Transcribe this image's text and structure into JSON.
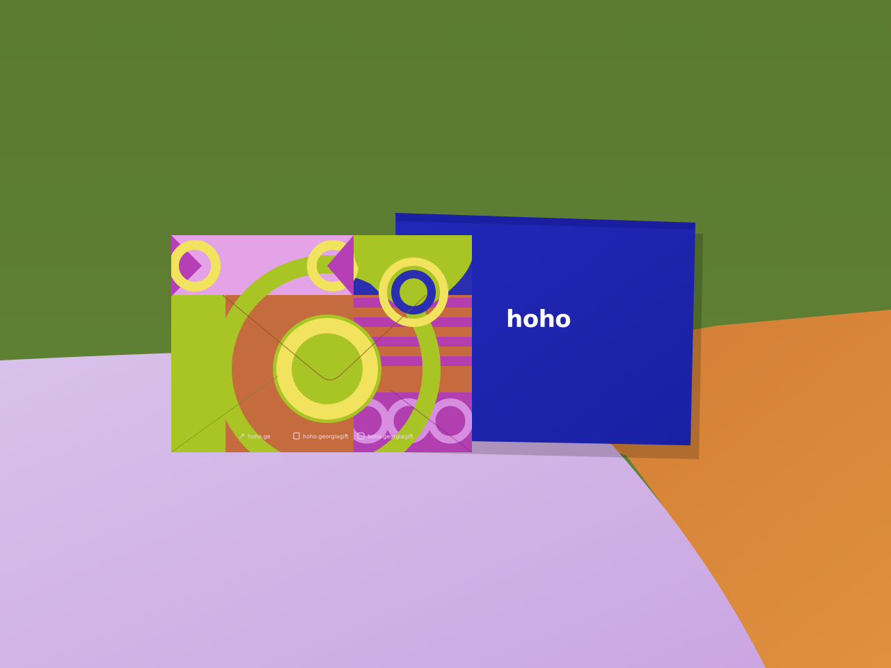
{
  "box": {
    "logo_text": "hoho"
  },
  "envelope": {
    "links": [
      {
        "icon": "link-icon",
        "label": "hoho.ge"
      },
      {
        "icon": "facebook-icon",
        "label": "hoho.georgiagift"
      },
      {
        "icon": "instagram-icon",
        "label": "hoho.georgiagift"
      }
    ]
  },
  "colors": {
    "wall_green": "#5f7f30",
    "surface_lilac": "#d6b8e8",
    "surface_orange": "#d9863a",
    "box_blue": "#1f26b2",
    "envelope_lime": "#a8c425",
    "envelope_magenta": "#b73fb5",
    "envelope_rust": "#c96f3f",
    "envelope_yellow": "#f2e35e",
    "envelope_pink": "#e6a6ea"
  }
}
